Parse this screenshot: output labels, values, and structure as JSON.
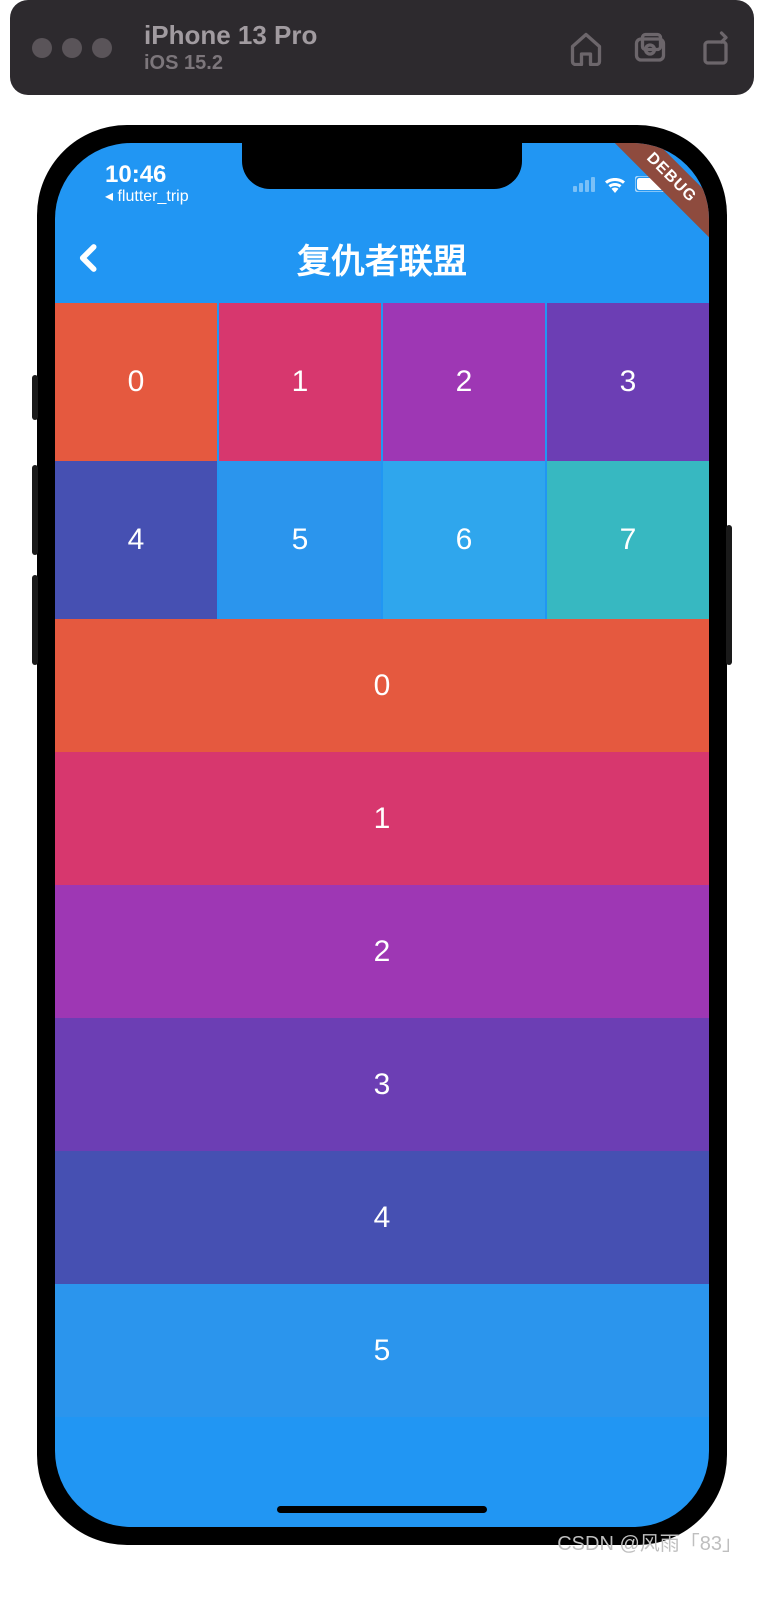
{
  "simulator": {
    "device": "iPhone 13 Pro",
    "os": "iOS 15.2"
  },
  "status": {
    "time": "10:46",
    "back_app": "◂ flutter_trip"
  },
  "debug_banner": "DEBUG",
  "app": {
    "title": "复仇者联盟"
  },
  "grid": [
    {
      "label": "0",
      "color": "#e5593f"
    },
    {
      "label": "1",
      "color": "#d7376e"
    },
    {
      "label": "2",
      "color": "#9e37b4"
    },
    {
      "label": "3",
      "color": "#6c3eb4"
    },
    {
      "label": "4",
      "color": "#4650b2"
    },
    {
      "label": "5",
      "color": "#2b95ed"
    },
    {
      "label": "6",
      "color": "#2fa6ed"
    },
    {
      "label": "7",
      "color": "#37b8c1"
    }
  ],
  "list": [
    {
      "label": "0",
      "color": "#e5593f"
    },
    {
      "label": "1",
      "color": "#d7376e"
    },
    {
      "label": "2",
      "color": "#9e37b4"
    },
    {
      "label": "3",
      "color": "#6c3eb4"
    },
    {
      "label": "4",
      "color": "#4650b2"
    },
    {
      "label": "5",
      "color": "#2b95ed"
    }
  ],
  "watermark": "CSDN @风雨「83」"
}
